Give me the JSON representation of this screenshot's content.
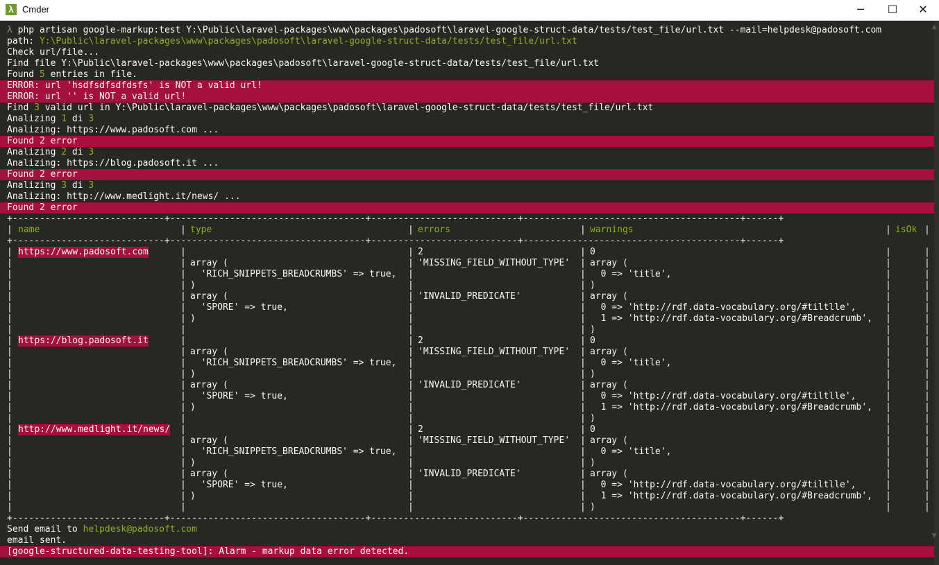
{
  "window": {
    "title": "Cmder",
    "app_icon": "λ",
    "minimize_glyph": "─",
    "maximize_glyph": "☐",
    "close_glyph": "✕"
  },
  "colors": {
    "background": "#272822",
    "text": "#f8f8f2",
    "accent_green": "#8bb01e",
    "error_bg": "#a5103e",
    "prompt": "#8e8e86"
  },
  "terminal": {
    "cmd_prompt": "λ",
    "cmd_text": " php artisan google-markup:test Y:\\Public\\laravel-packages\\www\\packages\\padosoft\\laravel-google-struct-data/tests/test_file/url.txt --mail=helpdesk@padosoft.com",
    "path_label": "path: ",
    "path_value": "Y:\\Public\\laravel-packages\\www\\packages\\padosoft\\laravel-google-struct-data/tests/test_file/url.txt",
    "check": "Check url/file...",
    "find_file": "Find file Y:\\Public\\laravel-packages\\www\\packages\\padosoft\\laravel-google-struct-data/tests/test_file/url.txt",
    "found_prefix": "Found ",
    "found_count": "5",
    "found_suffix": " entries in file.",
    "error1": "ERROR: url 'hsdfsdfsdfdsfs' is NOT a valid url!",
    "error2": "ERROR: url '' is NOT a valid url!",
    "find_valid_prefix": "Find ",
    "find_valid_count": "3",
    "find_valid_suffix": " valid url in Y:\\Public\\laravel-packages\\www\\packages\\padosoft\\laravel-google-struct-data/tests/test_file/url.txt",
    "analyze_blocks": [
      {
        "label": "Analizing ",
        "index": "1",
        "of_text": " di ",
        "total": "3",
        "analyzing": "Analizing: https://www.padosoft.com ...",
        "found": "Found 2 error"
      },
      {
        "label": "Analizing ",
        "index": "2",
        "of_text": " di ",
        "total": "3",
        "analyzing": "Analizing: https://blog.padosoft.it ...",
        "found": "Found 2 error"
      },
      {
        "label": "Analizing ",
        "index": "3",
        "of_text": " di ",
        "total": "3",
        "analyzing": "Analizing: http://www.medlight.it/news/ ...",
        "found": "Found 2 error"
      }
    ]
  },
  "table": {
    "border_line": "+----------------------------+------------------------------------+---------------------------+----------------------------------------+------+",
    "headers": {
      "name": "name",
      "type": "type",
      "errors": "errors",
      "warnings": "warnings",
      "isok": "isOk"
    },
    "rows": [
      {
        "name": "https://www.padosoft.com",
        "type_lines": [
          "",
          "array (",
          "  'RICH_SNIPPETS_BREADCRUMBS' => true,",
          ")",
          "array (",
          "  'SPORE' => true,",
          ")"
        ],
        "error_lines": [
          "2",
          "'MISSING_FIELD_WITHOUT_TYPE'",
          "",
          "",
          "'INVALID_PREDICATE'",
          "",
          ""
        ],
        "warning_lines": [
          "0",
          "array (",
          "  0 => 'title',",
          ")",
          "array (",
          "  0 => 'http://rdf.data-vocabulary.org/#tiltlle',",
          "  1 => 'http://rdf.data-vocabulary.org/#Breadcrumb',",
          ")"
        ]
      },
      {
        "name": "https://blog.padosoft.it",
        "type_lines": [
          "",
          "array (",
          "  'RICH_SNIPPETS_BREADCRUMBS' => true,",
          ")",
          "array (",
          "  'SPORE' => true,",
          ")"
        ],
        "error_lines": [
          "2",
          "'MISSING_FIELD_WITHOUT_TYPE'",
          "",
          "",
          "'INVALID_PREDICATE'",
          "",
          ""
        ],
        "warning_lines": [
          "0",
          "array (",
          "  0 => 'title',",
          ")",
          "array (",
          "  0 => 'http://rdf.data-vocabulary.org/#tiltlle',",
          "  1 => 'http://rdf.data-vocabulary.org/#Breadcrumb',",
          ")"
        ]
      },
      {
        "name": "http://www.medlight.it/news/",
        "type_lines": [
          "",
          "array (",
          "  'RICH_SNIPPETS_BREADCRUMBS' => true,",
          ")",
          "array (",
          "  'SPORE' => true,",
          ")"
        ],
        "error_lines": [
          "2",
          "'MISSING_FIELD_WITHOUT_TYPE'",
          "",
          "",
          "'INVALID_PREDICATE'",
          "",
          ""
        ],
        "warning_lines": [
          "0",
          "array (",
          "  0 => 'title',",
          ")",
          "array (",
          "  0 => 'http://rdf.data-vocabulary.org/#tiltlle',",
          "  1 => 'http://rdf.data-vocabulary.org/#Breadcrumb',",
          ")"
        ]
      }
    ]
  },
  "footer": {
    "send_email_prefix": "Send email to ",
    "send_email_address": "helpdesk@padosoft.com",
    "email_sent": "email sent.",
    "alarm": "[google-structured-data-testing-tool]: Alarm - markup data error detected."
  }
}
